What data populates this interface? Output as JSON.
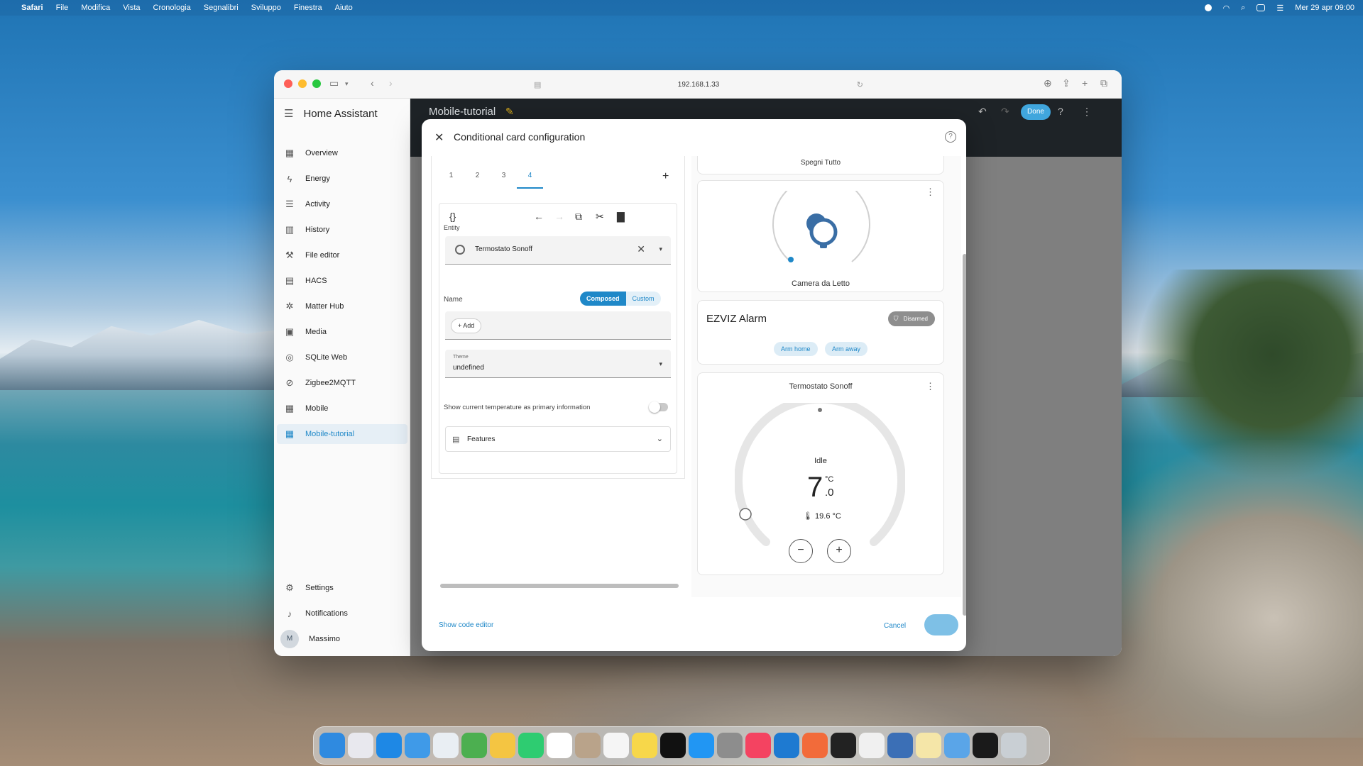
{
  "menubar": {
    "items": [
      "Safari",
      "File",
      "Modifica",
      "Vista",
      "Cronologia",
      "Segnalibri",
      "Sviluppo",
      "Finestra",
      "Aiuto"
    ],
    "clock": "Mer 29 apr  09:00"
  },
  "browser": {
    "url": "192.168.1.33"
  },
  "sidebar": {
    "title": "Home Assistant",
    "items": [
      {
        "label": "Overview",
        "icon": "grid-icon"
      },
      {
        "label": "Energy",
        "icon": "lightning-icon"
      },
      {
        "label": "Activity",
        "icon": "list-icon"
      },
      {
        "label": "History",
        "icon": "chart-icon"
      },
      {
        "label": "File editor",
        "icon": "wrench-icon"
      },
      {
        "label": "HACS",
        "icon": "store-icon"
      },
      {
        "label": "Matter Hub",
        "icon": "hub-icon"
      },
      {
        "label": "Media",
        "icon": "media-icon"
      },
      {
        "label": "SQLite Web",
        "icon": "database-icon"
      },
      {
        "label": "Zigbee2MQTT",
        "icon": "zigbee-icon"
      },
      {
        "label": "Mobile",
        "icon": "grid-icon"
      },
      {
        "label": "Mobile-tutorial",
        "icon": "grid-icon"
      }
    ],
    "bottom": {
      "settings": "Settings",
      "notifications": "Notifications",
      "user_initial": "M",
      "user": "Massimo"
    }
  },
  "header": {
    "dashboard_title": "Mobile-tutorial",
    "done_label": "Done"
  },
  "modal": {
    "title": "Conditional card configuration",
    "tabs": [
      "1",
      "2",
      "3",
      "4"
    ],
    "active_tab": "4",
    "entity_label": "Entity",
    "entity_value": "Termostato Sonoff",
    "name_label": "Name",
    "name_mode_on": "Composed",
    "name_mode_off": "Custom",
    "add_label": "Add",
    "theme_label": "Theme",
    "theme_value": "undefined",
    "toggle_label": "Show current temperature as primary information",
    "toggle_on": false,
    "features_label": "Features",
    "show_code_editor": "Show code editor",
    "cancel": "Cancel"
  },
  "preview": {
    "card_top_label": "Spegni Tutto",
    "light_card_name": "Camera da Letto",
    "alarm_title": "EZVIZ Alarm",
    "alarm_state": "Disarmed",
    "arm_home": "Arm home",
    "arm_away": "Arm away",
    "thermostat_name": "Termostato Sonoff",
    "thermostat_state": "Idle",
    "target_int": "7",
    "target_unit": "°C",
    "target_dec": ".0",
    "current_temp": "19.6 °C",
    "minus": "−",
    "plus": "+"
  },
  "colors": {
    "accent": "#1f88c8",
    "topbar": "#1e2327"
  }
}
